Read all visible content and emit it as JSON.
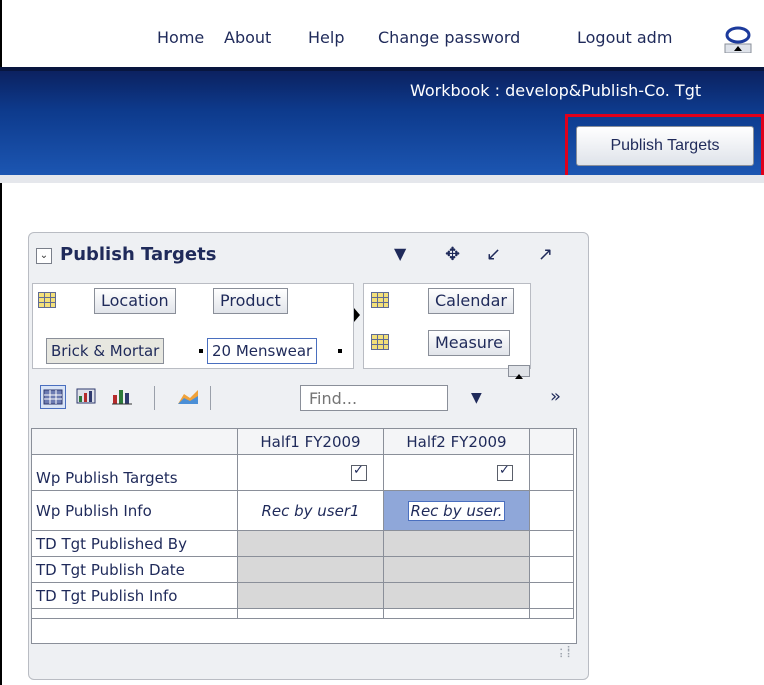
{
  "topnav": {
    "home": "Home",
    "about": "About",
    "help": "Help",
    "change_password": "Change password",
    "logout": "Logout adm"
  },
  "header": {
    "workbook_title": "Workbook : develop&Publish-Co. Tgt",
    "publish_button": "Publish Targets"
  },
  "panel": {
    "title": "Publish Targets",
    "pivot": {
      "location_label": "Location",
      "product_label": "Product",
      "calendar_label": "Calendar",
      "measure_label": "Measure",
      "location_member": "Brick & Mortar",
      "product_member": "20 Menswear"
    },
    "toolbar": {
      "find_placeholder": "Find..."
    },
    "table": {
      "columns": [
        "Half1 FY2009",
        "Half2 FY2009"
      ],
      "rows": [
        {
          "label": "Wp Publish Targets",
          "c1": "checked",
          "c2": "checked"
        },
        {
          "label": "Wp Publish Info",
          "c1": "Rec by user1",
          "c2": "Rec by user."
        },
        {
          "label": "TD Tgt Published By",
          "c1": "",
          "c2": ""
        },
        {
          "label": "TD Tgt Publish Date",
          "c1": "",
          "c2": ""
        },
        {
          "label": "TD Tgt Publish Info",
          "c1": "",
          "c2": ""
        }
      ]
    }
  },
  "colors": {
    "brand_blue": "#0d3a8c",
    "highlight_red": "#e0001b",
    "text_navy": "#1f2a5a"
  }
}
